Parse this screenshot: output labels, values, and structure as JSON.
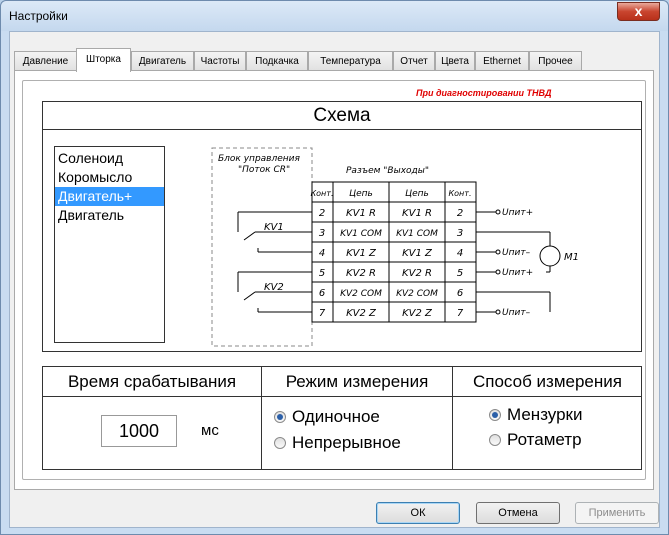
{
  "window": {
    "title": "Настройки",
    "close_glyph": "x"
  },
  "tabs": [
    {
      "label": "Давление"
    },
    {
      "label": "Шторка",
      "active": true
    },
    {
      "label": "Двигатель"
    },
    {
      "label": "Частоты"
    },
    {
      "label": "Подкачка"
    },
    {
      "label": "Температура"
    },
    {
      "label": "Отчет"
    },
    {
      "label": "Цвета"
    },
    {
      "label": "Ethernet"
    },
    {
      "label": "Прочее"
    }
  ],
  "schema": {
    "title": "Схема",
    "list_items": [
      "Соленоид",
      "Коромысло",
      "Двигатель+",
      "Двигатель"
    ],
    "selected_index": 2,
    "diagram": {
      "block_label_1": "Блок управления",
      "block_label_2": "\"Поток CR\"",
      "connector_title": "Разъем \"Выходы\"",
      "headers": [
        "Конт.",
        "Цепь",
        "Цепь",
        "Конт."
      ],
      "rows": [
        [
          "2",
          "KV1 R",
          "KV1 R",
          "2"
        ],
        [
          "3",
          "KV1 COM",
          "KV1 COM",
          "3"
        ],
        [
          "4",
          "KV1 Z",
          "KV1 Z",
          "4"
        ],
        [
          "5",
          "KV2 R",
          "KV2 R",
          "5"
        ],
        [
          "6",
          "KV2 COM",
          "KV2 COM",
          "6"
        ],
        [
          "7",
          "KV2 Z",
          "KV2 Z",
          "7"
        ]
      ],
      "relay1": "KV1",
      "relay2": "KV2",
      "out_labels": [
        "Uпит+",
        "Uпит–",
        "Uпит+",
        "Uпит–"
      ],
      "motor": "M1"
    }
  },
  "params": {
    "time_header": "Время срабатывания",
    "mode_header": "Режим измерения",
    "method_header": "Способ измерения",
    "time_value": "1000",
    "time_unit": "мс",
    "mode_options": [
      "Одиночное",
      "Непрерывное"
    ],
    "mode_selected": 0,
    "method_options": [
      "Мензурки",
      "Ротаметр"
    ],
    "method_selected": 0,
    "note": "При диагностировании ТНВД"
  },
  "buttons": {
    "ok": "ОК",
    "cancel": "Отмена",
    "apply": "Применить"
  },
  "colors": {
    "selection": "#3399ff",
    "note": "#e00000",
    "close": "#c9452f"
  }
}
